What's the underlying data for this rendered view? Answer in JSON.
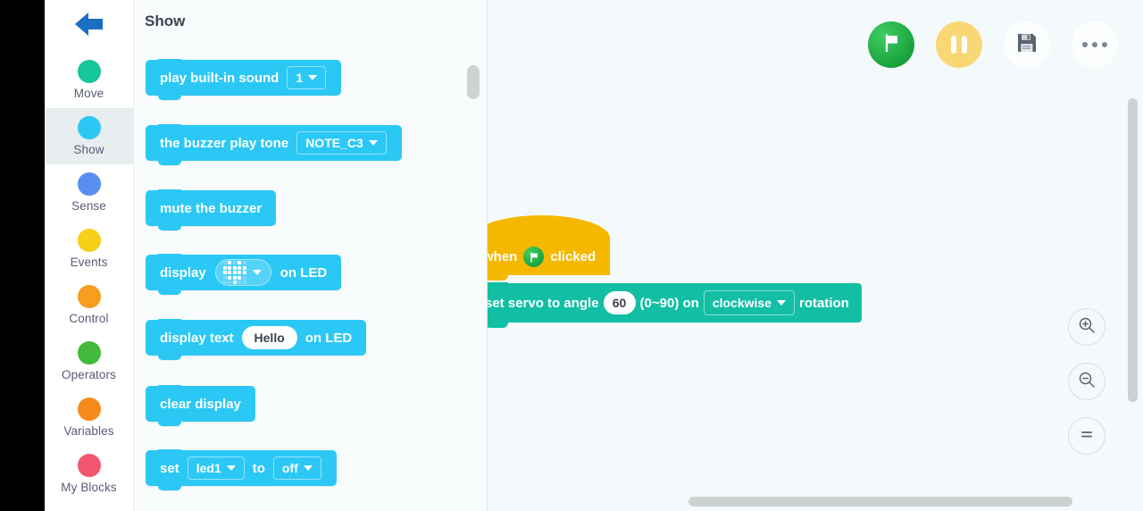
{
  "app": {
    "back_icon": "back-arrow-icon"
  },
  "sidebar": {
    "items": [
      {
        "label": "Move",
        "color": "#16c79a",
        "selected": false
      },
      {
        "label": "Show",
        "color": "#2bc8f5",
        "selected": true
      },
      {
        "label": "Sense",
        "color": "#5a8ef0",
        "selected": false
      },
      {
        "label": "Events",
        "color": "#f7d117",
        "selected": false
      },
      {
        "label": "Control",
        "color": "#f79d20",
        "selected": false
      },
      {
        "label": "Operators",
        "color": "#42b93c",
        "selected": false
      },
      {
        "label": "Variables",
        "color": "#f78a1c",
        "selected": false
      },
      {
        "label": "My Blocks",
        "color": "#f2566f",
        "selected": false
      }
    ]
  },
  "palette": {
    "title": "Show",
    "block_color": "#2bc8f5",
    "blocks": [
      {
        "id": "play-built-in-sound",
        "parts": [
          {
            "type": "text",
            "value": "play built-in sound"
          },
          {
            "type": "field",
            "value": "1",
            "dropdown": true
          }
        ]
      },
      {
        "id": "buzzer-play-tone",
        "parts": [
          {
            "type": "text",
            "value": "the buzzer play tone"
          },
          {
            "type": "field",
            "value": "NOTE_C3",
            "dropdown": true
          }
        ]
      },
      {
        "id": "mute-the-buzzer",
        "parts": [
          {
            "type": "text",
            "value": "mute the buzzer"
          }
        ]
      },
      {
        "id": "display-matrix-on-led",
        "parts": [
          {
            "type": "text",
            "value": "display"
          },
          {
            "type": "matrix",
            "value": "heart-led-matrix",
            "dropdown": true
          },
          {
            "type": "text",
            "value": "on LED"
          }
        ]
      },
      {
        "id": "display-text-on-led",
        "parts": [
          {
            "type": "text",
            "value": "display text"
          },
          {
            "type": "field_white",
            "value": "Hello"
          },
          {
            "type": "text",
            "value": "on LED"
          }
        ]
      },
      {
        "id": "clear-display",
        "parts": [
          {
            "type": "text",
            "value": "clear display"
          }
        ]
      },
      {
        "id": "set-led-to-state",
        "parts": [
          {
            "type": "text",
            "value": "set"
          },
          {
            "type": "field",
            "value": "led1",
            "dropdown": true
          },
          {
            "type": "text",
            "value": "to"
          },
          {
            "type": "field",
            "value": "off",
            "dropdown": true
          }
        ]
      }
    ]
  },
  "toolbar": {
    "buttons": [
      {
        "name": "run-green-flag-button",
        "icon": "green-flag-icon"
      },
      {
        "name": "pause-button",
        "icon": "pause-icon"
      },
      {
        "name": "save-button",
        "icon": "floppy-disk-icon"
      },
      {
        "name": "more-options-button",
        "icon": "ellipsis-icon"
      }
    ]
  },
  "zoom_controls": [
    {
      "name": "zoom-in-button",
      "icon": "magnifier-plus-icon",
      "label": "+"
    },
    {
      "name": "zoom-out-button",
      "icon": "magnifier-minus-icon",
      "label": "−"
    },
    {
      "name": "zoom-reset-button",
      "icon": "equals-icon",
      "label": "="
    }
  ],
  "script": {
    "hat_block": {
      "color": "#f5b800",
      "prefix": "when",
      "icon": "green-flag-icon",
      "suffix": "clicked"
    },
    "servo_block": {
      "color": "#12bfa4",
      "label_before": "set servo to angle",
      "angle_value": "60",
      "range_hint": "(0~90) on",
      "direction": "clockwise",
      "label_after": "rotation"
    }
  }
}
